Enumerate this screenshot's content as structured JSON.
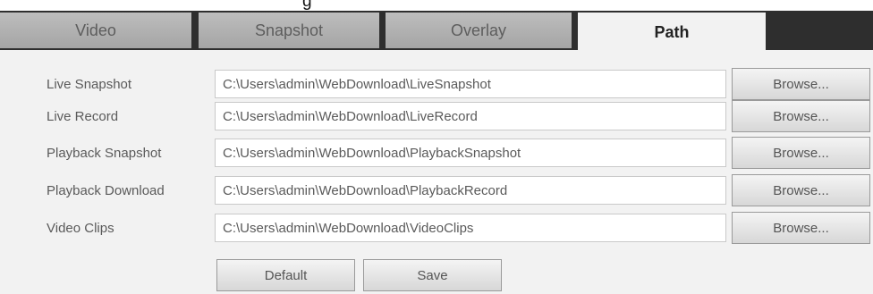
{
  "heading_fragment": "g",
  "tabs": [
    {
      "label": "Video",
      "active": false
    },
    {
      "label": "Snapshot",
      "active": false
    },
    {
      "label": "Overlay",
      "active": false
    },
    {
      "label": "Path",
      "active": true
    }
  ],
  "paths": [
    {
      "label": "Live Snapshot",
      "value": "C:\\Users\\admin\\WebDownload\\LiveSnapshot",
      "browse_label": "Browse..."
    },
    {
      "label": "Live Record",
      "value": "C:\\Users\\admin\\WebDownload\\LiveRecord",
      "browse_label": "Browse..."
    },
    {
      "label": "Playback Snapshot",
      "value": "C:\\Users\\admin\\WebDownload\\PlaybackSnapshot",
      "browse_label": "Browse..."
    },
    {
      "label": "Playback Download",
      "value": "C:\\Users\\admin\\WebDownload\\PlaybackRecord",
      "browse_label": "Browse..."
    },
    {
      "label": "Video Clips",
      "value": "C:\\Users\\admin\\WebDownload\\VideoClips",
      "browse_label": "Browse..."
    }
  ],
  "actions": {
    "default_label": "Default",
    "save_label": "Save"
  },
  "colors": {
    "tabbar_bg": "#2e2e2e",
    "tab_inactive": "#b3b3b3",
    "tab_active": "#f2f2f2",
    "panel_bg": "#f2f2f2"
  }
}
